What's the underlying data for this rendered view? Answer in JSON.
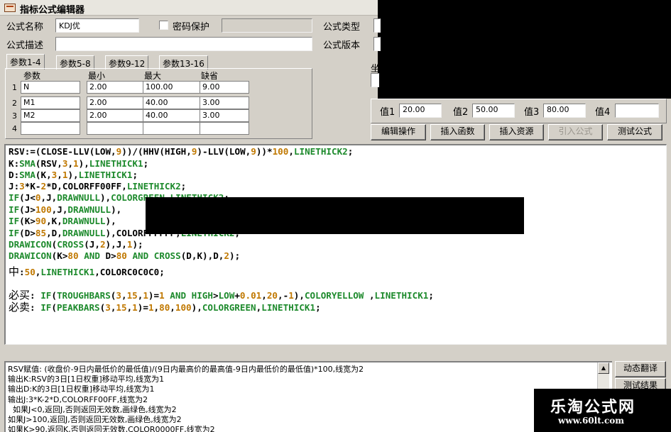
{
  "window": {
    "title": "指标公式编辑器"
  },
  "form": {
    "name_label": "公式名称",
    "name_value": "KDJ优",
    "password_label": "密码保护",
    "desc_label": "公式描述",
    "desc_value": "",
    "type_label": "公式类型",
    "version_label": "公式版本",
    "coord_label": "坐"
  },
  "params": {
    "tabs": [
      "参数1-4",
      "参数5-8",
      "参数9-12",
      "参数13-16"
    ],
    "headers": [
      "参数",
      "最小",
      "最大",
      "缺省"
    ],
    "rows": [
      {
        "num": "1",
        "name": "N",
        "min": "2.00",
        "max": "100.00",
        "default": "9.00"
      },
      {
        "num": "2",
        "name": "M1",
        "min": "2.00",
        "max": "40.00",
        "default": "3.00"
      },
      {
        "num": "3",
        "name": "M2",
        "min": "2.00",
        "max": "40.00",
        "default": "3.00"
      },
      {
        "num": "4",
        "name": "",
        "min": "",
        "max": "",
        "default": ""
      }
    ]
  },
  "values": {
    "v1_label": "值1",
    "v1": "20.00",
    "v2_label": "值2",
    "v2": "50.00",
    "v3_label": "值3",
    "v3": "80.00",
    "v4_label": "值4",
    "v4": ""
  },
  "buttons": {
    "edit": "编辑操作",
    "insert_func": "插入函数",
    "insert_res": "插入资源",
    "import": "引入公式",
    "test": "测试公式",
    "dyn_translate": "动态翻译",
    "test_result": "测试结果"
  },
  "code": [
    [
      [
        "RSV:=(CLOSE-LLV(LOW,",
        ""
      ],
      [
        "9",
        "num"
      ],
      [
        "))/(HHV(HIGH,",
        ""
      ],
      [
        "9",
        "num"
      ],
      [
        ")-LLV(LOW,",
        ""
      ],
      [
        "9",
        "num"
      ],
      [
        "))*",
        ""
      ],
      [
        "100",
        "num"
      ],
      [
        ",",
        ""
      ],
      [
        "LINETHICK2",
        "kw"
      ],
      [
        ";",
        ""
      ]
    ],
    [
      [
        "K:",
        ""
      ],
      [
        "SMA",
        "kw"
      ],
      [
        "(RSV,",
        ""
      ],
      [
        "3",
        "num"
      ],
      [
        ",",
        ""
      ],
      [
        "1",
        "num"
      ],
      [
        "),",
        ""
      ],
      [
        "LINETHICK1",
        "kw"
      ],
      [
        ";",
        ""
      ]
    ],
    [
      [
        "D:",
        ""
      ],
      [
        "SMA",
        "kw"
      ],
      [
        "(K,",
        ""
      ],
      [
        "3",
        "num"
      ],
      [
        ",",
        ""
      ],
      [
        "1",
        "num"
      ],
      [
        "),",
        ""
      ],
      [
        "LINETHICK1",
        "kw"
      ],
      [
        ";",
        ""
      ]
    ],
    [
      [
        "J:",
        ""
      ],
      [
        "3",
        "num"
      ],
      [
        "*K-",
        ""
      ],
      [
        "2",
        "num"
      ],
      [
        "*D,COLORFF00FF,",
        ""
      ],
      [
        "LINETHICK2",
        "kw"
      ],
      [
        ";",
        ""
      ]
    ],
    [
      [
        "IF",
        "kw"
      ],
      [
        "(J<",
        ""
      ],
      [
        "0",
        "num"
      ],
      [
        ",J,",
        ""
      ],
      [
        "DRAWNULL",
        "kw"
      ],
      [
        "),",
        ""
      ],
      [
        "COLORGREEN",
        "kw"
      ],
      [
        ",",
        ""
      ],
      [
        "LINETHICK2",
        "kw"
      ],
      [
        ";",
        ""
      ]
    ],
    [
      [
        "IF",
        "kw"
      ],
      [
        "(J>",
        ""
      ],
      [
        "100",
        "num"
      ],
      [
        ",J,",
        ""
      ],
      [
        "DRAWNULL",
        "kw"
      ],
      [
        "),",
        ""
      ]
    ],
    [
      [
        "IF",
        "kw"
      ],
      [
        "(K>",
        ""
      ],
      [
        "90",
        "num"
      ],
      [
        ",K,",
        ""
      ],
      [
        "DRAWNULL",
        "kw"
      ],
      [
        "),",
        ""
      ]
    ],
    [
      [
        "IF",
        "kw"
      ],
      [
        "(D>",
        ""
      ],
      [
        "85",
        "num"
      ],
      [
        ",D,",
        ""
      ],
      [
        "DRAWNULL",
        "kw"
      ],
      [
        "),COLORFFFFFF,",
        ""
      ],
      [
        "LINETHICK2",
        "kw"
      ],
      [
        ";",
        ""
      ]
    ],
    [
      [
        "DRAWICON",
        "kw"
      ],
      [
        "(",
        ""
      ],
      [
        "CROSS",
        "kw"
      ],
      [
        "(J,",
        ""
      ],
      [
        "2",
        "num"
      ],
      [
        "),J,",
        ""
      ],
      [
        "1",
        "num"
      ],
      [
        ");",
        ""
      ]
    ],
    [
      [
        "DRAWICON",
        "kw"
      ],
      [
        "(K>",
        ""
      ],
      [
        "80",
        "num"
      ],
      [
        " ",
        ""
      ],
      [
        "AND",
        "kw"
      ],
      [
        " D>",
        ""
      ],
      [
        "80",
        "num"
      ],
      [
        " ",
        ""
      ],
      [
        "AND",
        "kw"
      ],
      [
        " ",
        ""
      ],
      [
        "CROSS",
        "kw"
      ],
      [
        "(D,K),D,",
        ""
      ],
      [
        "2",
        "num"
      ],
      [
        ");",
        ""
      ]
    ],
    [
      [
        "中",
        "cjk"
      ],
      [
        ":",
        ""
      ],
      [
        "50",
        "num"
      ],
      [
        ",",
        ""
      ],
      [
        "LINETHICK1",
        "kw"
      ],
      [
        ",COLORC0C0C0;",
        ""
      ]
    ],
    [],
    [
      [
        "必买",
        "cjk"
      ],
      [
        ": ",
        ""
      ],
      [
        "IF",
        "kw"
      ],
      [
        "(",
        ""
      ],
      [
        "TROUGHBARS",
        "kw"
      ],
      [
        "(",
        ""
      ],
      [
        "3",
        "num"
      ],
      [
        ",",
        ""
      ],
      [
        "15",
        "num"
      ],
      [
        ",",
        ""
      ],
      [
        "1",
        "num"
      ],
      [
        ")=",
        ""
      ],
      [
        "1",
        "num"
      ],
      [
        " ",
        ""
      ],
      [
        "AND",
        "kw"
      ],
      [
        " ",
        ""
      ],
      [
        "HIGH",
        "kw"
      ],
      [
        ">",
        ""
      ],
      [
        "LOW",
        "kw"
      ],
      [
        "+",
        ""
      ],
      [
        "0.01",
        "num"
      ],
      [
        ",",
        ""
      ],
      [
        "20",
        "num"
      ],
      [
        ",-",
        ""
      ],
      [
        "1",
        "num"
      ],
      [
        "),",
        ""
      ],
      [
        "COLORYELLOW",
        "kw"
      ],
      [
        " ,",
        ""
      ],
      [
        "LINETHICK1",
        "kw"
      ],
      [
        ";",
        ""
      ]
    ],
    [
      [
        "必卖",
        "cjk"
      ],
      [
        ": ",
        ""
      ],
      [
        "IF",
        "kw"
      ],
      [
        "(",
        ""
      ],
      [
        "PEAKBARS",
        "kw"
      ],
      [
        "(",
        ""
      ],
      [
        "3",
        "num"
      ],
      [
        ",",
        ""
      ],
      [
        "15",
        "num"
      ],
      [
        ",",
        ""
      ],
      [
        "1",
        "num"
      ],
      [
        ")=",
        ""
      ],
      [
        "1",
        "num"
      ],
      [
        ",",
        ""
      ],
      [
        "80",
        "num"
      ],
      [
        ",",
        ""
      ],
      [
        "100",
        "num"
      ],
      [
        "),",
        ""
      ],
      [
        "COLORGREEN",
        "kw"
      ],
      [
        ",",
        ""
      ],
      [
        "LINETHICK1",
        "kw"
      ],
      [
        ";",
        ""
      ]
    ]
  ],
  "console": [
    "RSV赋值: (收盘价-9日内最低价的最低值)/(9日内最高价的最高值-9日内最低价的最低值)*100,线宽为2",
    "输出K:RSV的3日[1日权重]移动平均,线宽为1",
    "输出D:K的3日[1日权重]移动平均,线宽为1",
    "输出J:3*K-2*D,COLORFF00FF,线宽为2",
    "  如果J<0,返回J,否则返回无效数,画绿色,线宽为2",
    "如果J>100,返回J,否则返回无效数,画绿色,线宽为2",
    "如果K>90,返回K,否则返回无效数,COLOR0000FF,线宽为2"
  ],
  "watermark": {
    "title": "乐淘公式网",
    "url": "www.60lt.com"
  },
  "colors": {
    "keyword": "#1d8a2c",
    "number": "#c07800",
    "face": "#d4d0c8"
  }
}
